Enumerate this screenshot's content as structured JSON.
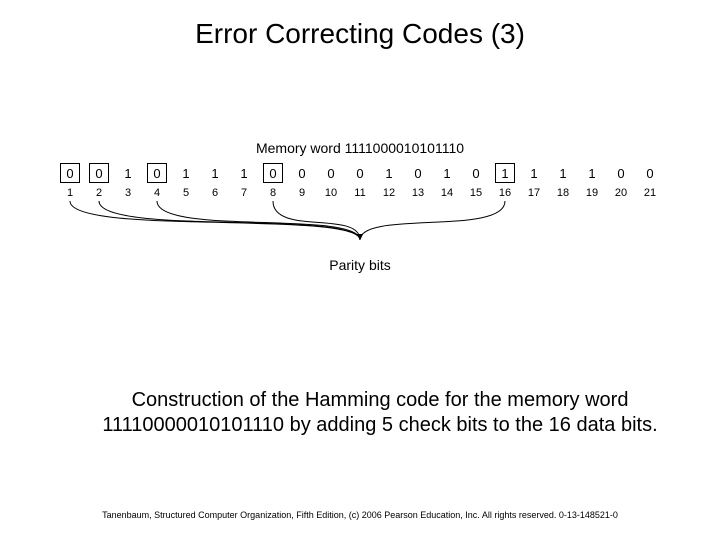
{
  "title": "Error Correcting Codes (3)",
  "figure": {
    "memory_word_label": "Memory word 1111000010101110",
    "cells": [
      {
        "val": "0",
        "idx": "1",
        "parity": true
      },
      {
        "val": "0",
        "idx": "2",
        "parity": true
      },
      {
        "val": "1",
        "idx": "3",
        "parity": false
      },
      {
        "val": "0",
        "idx": "4",
        "parity": true
      },
      {
        "val": "1",
        "idx": "5",
        "parity": false
      },
      {
        "val": "1",
        "idx": "6",
        "parity": false
      },
      {
        "val": "1",
        "idx": "7",
        "parity": false
      },
      {
        "val": "0",
        "idx": "8",
        "parity": true
      },
      {
        "val": "0",
        "idx": "9",
        "parity": false
      },
      {
        "val": "0",
        "idx": "10",
        "parity": false
      },
      {
        "val": "0",
        "idx": "11",
        "parity": false
      },
      {
        "val": "1",
        "idx": "12",
        "parity": false
      },
      {
        "val": "0",
        "idx": "13",
        "parity": false
      },
      {
        "val": "1",
        "idx": "14",
        "parity": false
      },
      {
        "val": "0",
        "idx": "15",
        "parity": false
      },
      {
        "val": "1",
        "idx": "16",
        "parity": true
      },
      {
        "val": "1",
        "idx": "17",
        "parity": false
      },
      {
        "val": "1",
        "idx": "18",
        "parity": false
      },
      {
        "val": "1",
        "idx": "19",
        "parity": false
      },
      {
        "val": "0",
        "idx": "20",
        "parity": false
      },
      {
        "val": "0",
        "idx": "21",
        "parity": false
      }
    ],
    "parity_label": "Parity bits"
  },
  "caption": "Construction of the Hamming code for the memory word 11110000010101110 by adding 5 check bits to the 16 data bits.",
  "footer": "Tanenbaum, Structured Computer Organization, Fifth Edition, (c) 2006 Pearson Education, Inc. All rights reserved. 0-13-148521-0"
}
